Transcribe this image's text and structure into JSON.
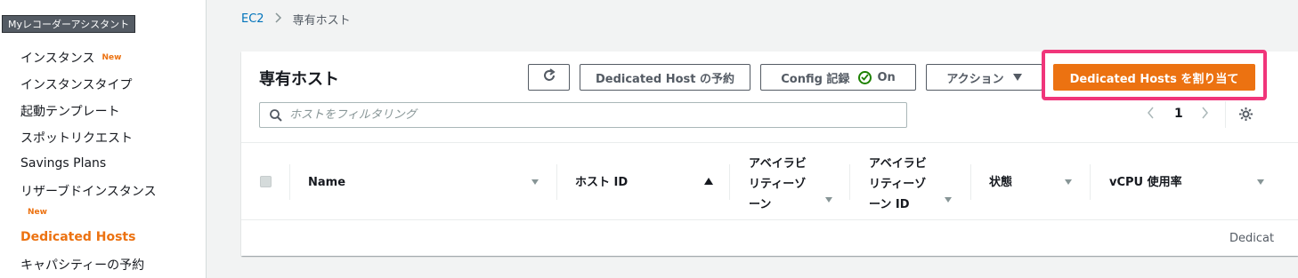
{
  "tooltip": "Myレコーダーアシスタント",
  "sidebar": {
    "items": [
      {
        "label": "インスタンス",
        "badge": "New"
      },
      {
        "label": "インスタンスタイプ"
      },
      {
        "label": "起動テンプレート"
      },
      {
        "label": "スポットリクエスト"
      },
      {
        "label": "Savings Plans"
      },
      {
        "label": "リザーブドインスタンス",
        "badge": "New"
      },
      {
        "label": "Dedicated Hosts",
        "active": true
      },
      {
        "label": "キャパシティーの予約"
      }
    ]
  },
  "breadcrumb": {
    "root": "EC2",
    "current": "専有ホスト"
  },
  "panel": {
    "title": "専有ホスト",
    "buttons": {
      "refresh_icon": "refresh-icon",
      "reserve": "Dedicated Host の予約",
      "config": "Config 記録",
      "config_state": "On",
      "actions": "アクション",
      "allocate": "Dedicated Hosts を割り当て"
    },
    "search": {
      "placeholder": "ホストをフィルタリング"
    },
    "pager": {
      "page": "1"
    }
  },
  "table": {
    "columns": [
      {
        "label": "Name"
      },
      {
        "label": "ホスト ID"
      },
      {
        "label": "アベイラビリティーゾーン"
      },
      {
        "label": "アベイラビリティーゾーン ID"
      },
      {
        "label": "状態"
      },
      {
        "label": "vCPU 使用率"
      }
    ],
    "row_partial_text": "Dedicat"
  },
  "colors": {
    "accent": "#ec7211",
    "highlight": "#f0357a",
    "link": "#0073bb",
    "ok": "#1d8102"
  }
}
